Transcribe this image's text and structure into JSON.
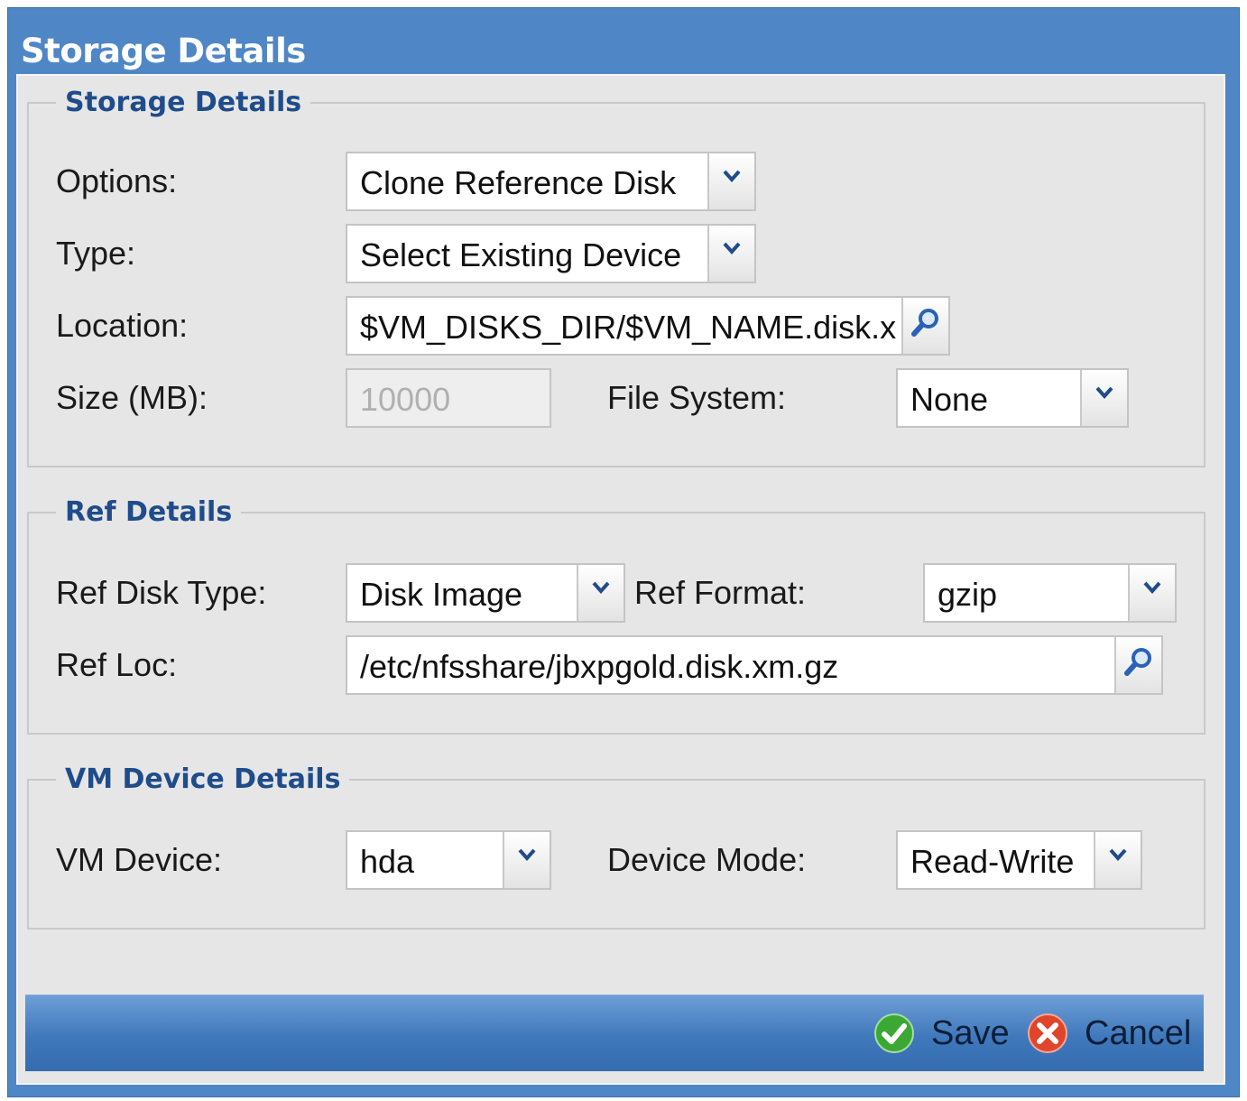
{
  "window": {
    "title": "Storage Details"
  },
  "storage_details": {
    "legend": "Storage Details",
    "options": {
      "label": "Options:",
      "value": "Clone Reference Disk"
    },
    "type": {
      "label": "Type:",
      "value": "Select Existing Device"
    },
    "location": {
      "label": "Location:",
      "value": "$VM_DISKS_DIR/$VM_NAME.disk.x"
    },
    "size": {
      "label": "Size (MB):",
      "value": "10000"
    },
    "file_system": {
      "label": "File System:",
      "value": "None"
    }
  },
  "ref_details": {
    "legend": "Ref Details",
    "ref_disk_type": {
      "label": "Ref Disk Type:",
      "value": "Disk Image"
    },
    "ref_format": {
      "label": "Ref Format:",
      "value": "gzip"
    },
    "ref_loc": {
      "label": "Ref Loc:",
      "value": "/etc/nfsshare/jbxpgold.disk.xm.gz"
    }
  },
  "vm_device_details": {
    "legend": "VM Device Details",
    "vm_device": {
      "label": "VM Device:",
      "value": "hda"
    },
    "device_mode": {
      "label": "Device Mode:",
      "value": "Read-Write"
    }
  },
  "footer": {
    "save_label": "Save",
    "cancel_label": "Cancel"
  },
  "icons": {
    "dropdown": "chevron-down-icon",
    "search": "search-icon",
    "save": "check-icon",
    "cancel": "close-icon"
  },
  "colors": {
    "header": "#4f86c6",
    "legend": "#1f4c8a",
    "save_green": "#3aa832",
    "cancel_red": "#e0452b"
  }
}
